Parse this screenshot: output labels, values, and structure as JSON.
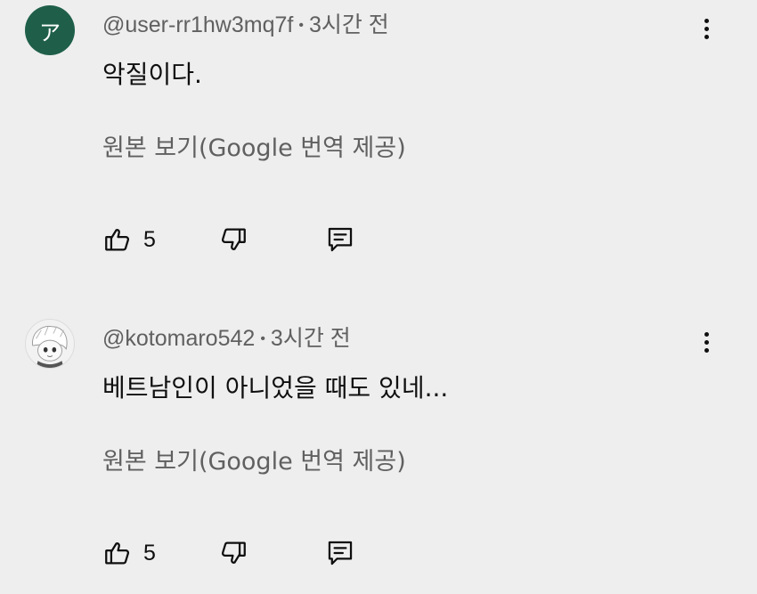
{
  "comments": [
    {
      "avatar_letter": "ア",
      "avatar_color": "#1f5f4a",
      "author": "@user-rr1hw3mq7f",
      "separator": "•",
      "time": "3시간 전",
      "text": "악질이다.",
      "translate_label": "원본 보기(Google 번역 제공)",
      "likes": "5",
      "icons": [
        "thumb-up-icon",
        "thumb-down-icon",
        "reply-icon",
        "more-vert-icon"
      ]
    },
    {
      "avatar_letter": "",
      "author": "@kotomaro542",
      "separator": "•",
      "time": "3시간 전",
      "text": "베트남인이 아니었을 때도 있네...",
      "translate_label": "원본 보기(Google 번역 제공)",
      "likes": "5",
      "icons": [
        "thumb-up-icon",
        "thumb-down-icon",
        "reply-icon",
        "more-vert-icon"
      ]
    }
  ],
  "colors": {
    "background": "#eeeeee",
    "primary_text": "#0f0f0f",
    "secondary_text": "#606060"
  }
}
